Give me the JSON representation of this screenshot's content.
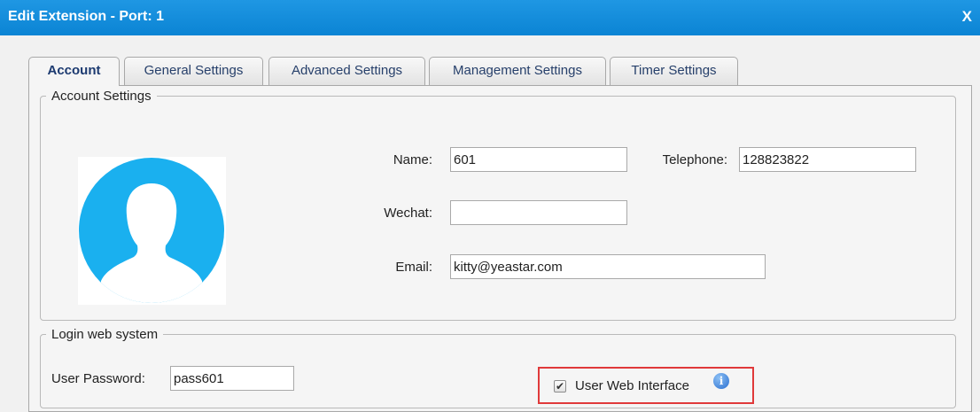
{
  "window": {
    "title": "Edit Extension - Port: 1",
    "close_label": "X"
  },
  "tabs": [
    {
      "label": "Account",
      "active": true
    },
    {
      "label": "General Settings",
      "active": false
    },
    {
      "label": "Advanced Settings",
      "active": false
    },
    {
      "label": "Management Settings",
      "active": false
    },
    {
      "label": "Timer Settings",
      "active": false
    }
  ],
  "account_settings": {
    "legend": "Account Settings",
    "avatar_icon": "user-silhouette-icon",
    "name": {
      "label": "Name:",
      "value": "601"
    },
    "telephone": {
      "label": "Telephone:",
      "value": "128823822"
    },
    "wechat": {
      "label": "Wechat:",
      "value": ""
    },
    "email": {
      "label": "Email:",
      "value": "kitty@yeastar.com"
    }
  },
  "login": {
    "legend": "Login web system",
    "password": {
      "label": "User Password:",
      "value": "pass601"
    },
    "web_interface": {
      "label": "User Web Interface",
      "checked": true,
      "info_icon": "info-icon"
    }
  },
  "colors": {
    "titlebar": "#0b84d4",
    "avatar": "#1ab0ef",
    "highlight_box": "#e0393a",
    "tab_text": "#27406b"
  }
}
